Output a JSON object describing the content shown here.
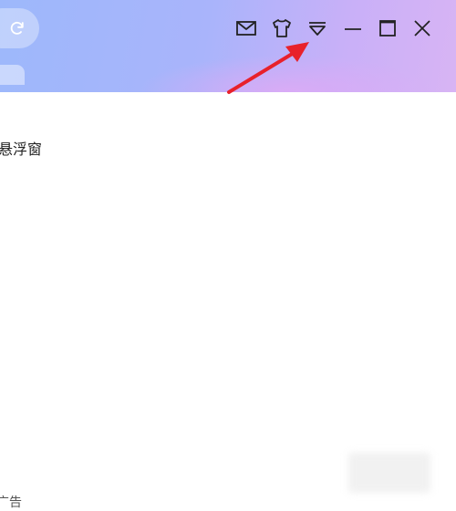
{
  "titlebar": {
    "buttons": {
      "mail": "mail-icon",
      "skin": "tshirt-icon",
      "menu": "menu-dropdown-icon",
      "minimize": "minimize-icon",
      "maximize": "maximize-icon",
      "close": "close-icon"
    },
    "refresh": "refresh-icon"
  },
  "annotation": {
    "arrow_color": "#e8212b"
  },
  "content": {
    "label": "悬浮窗",
    "bottom_text": "广告"
  }
}
